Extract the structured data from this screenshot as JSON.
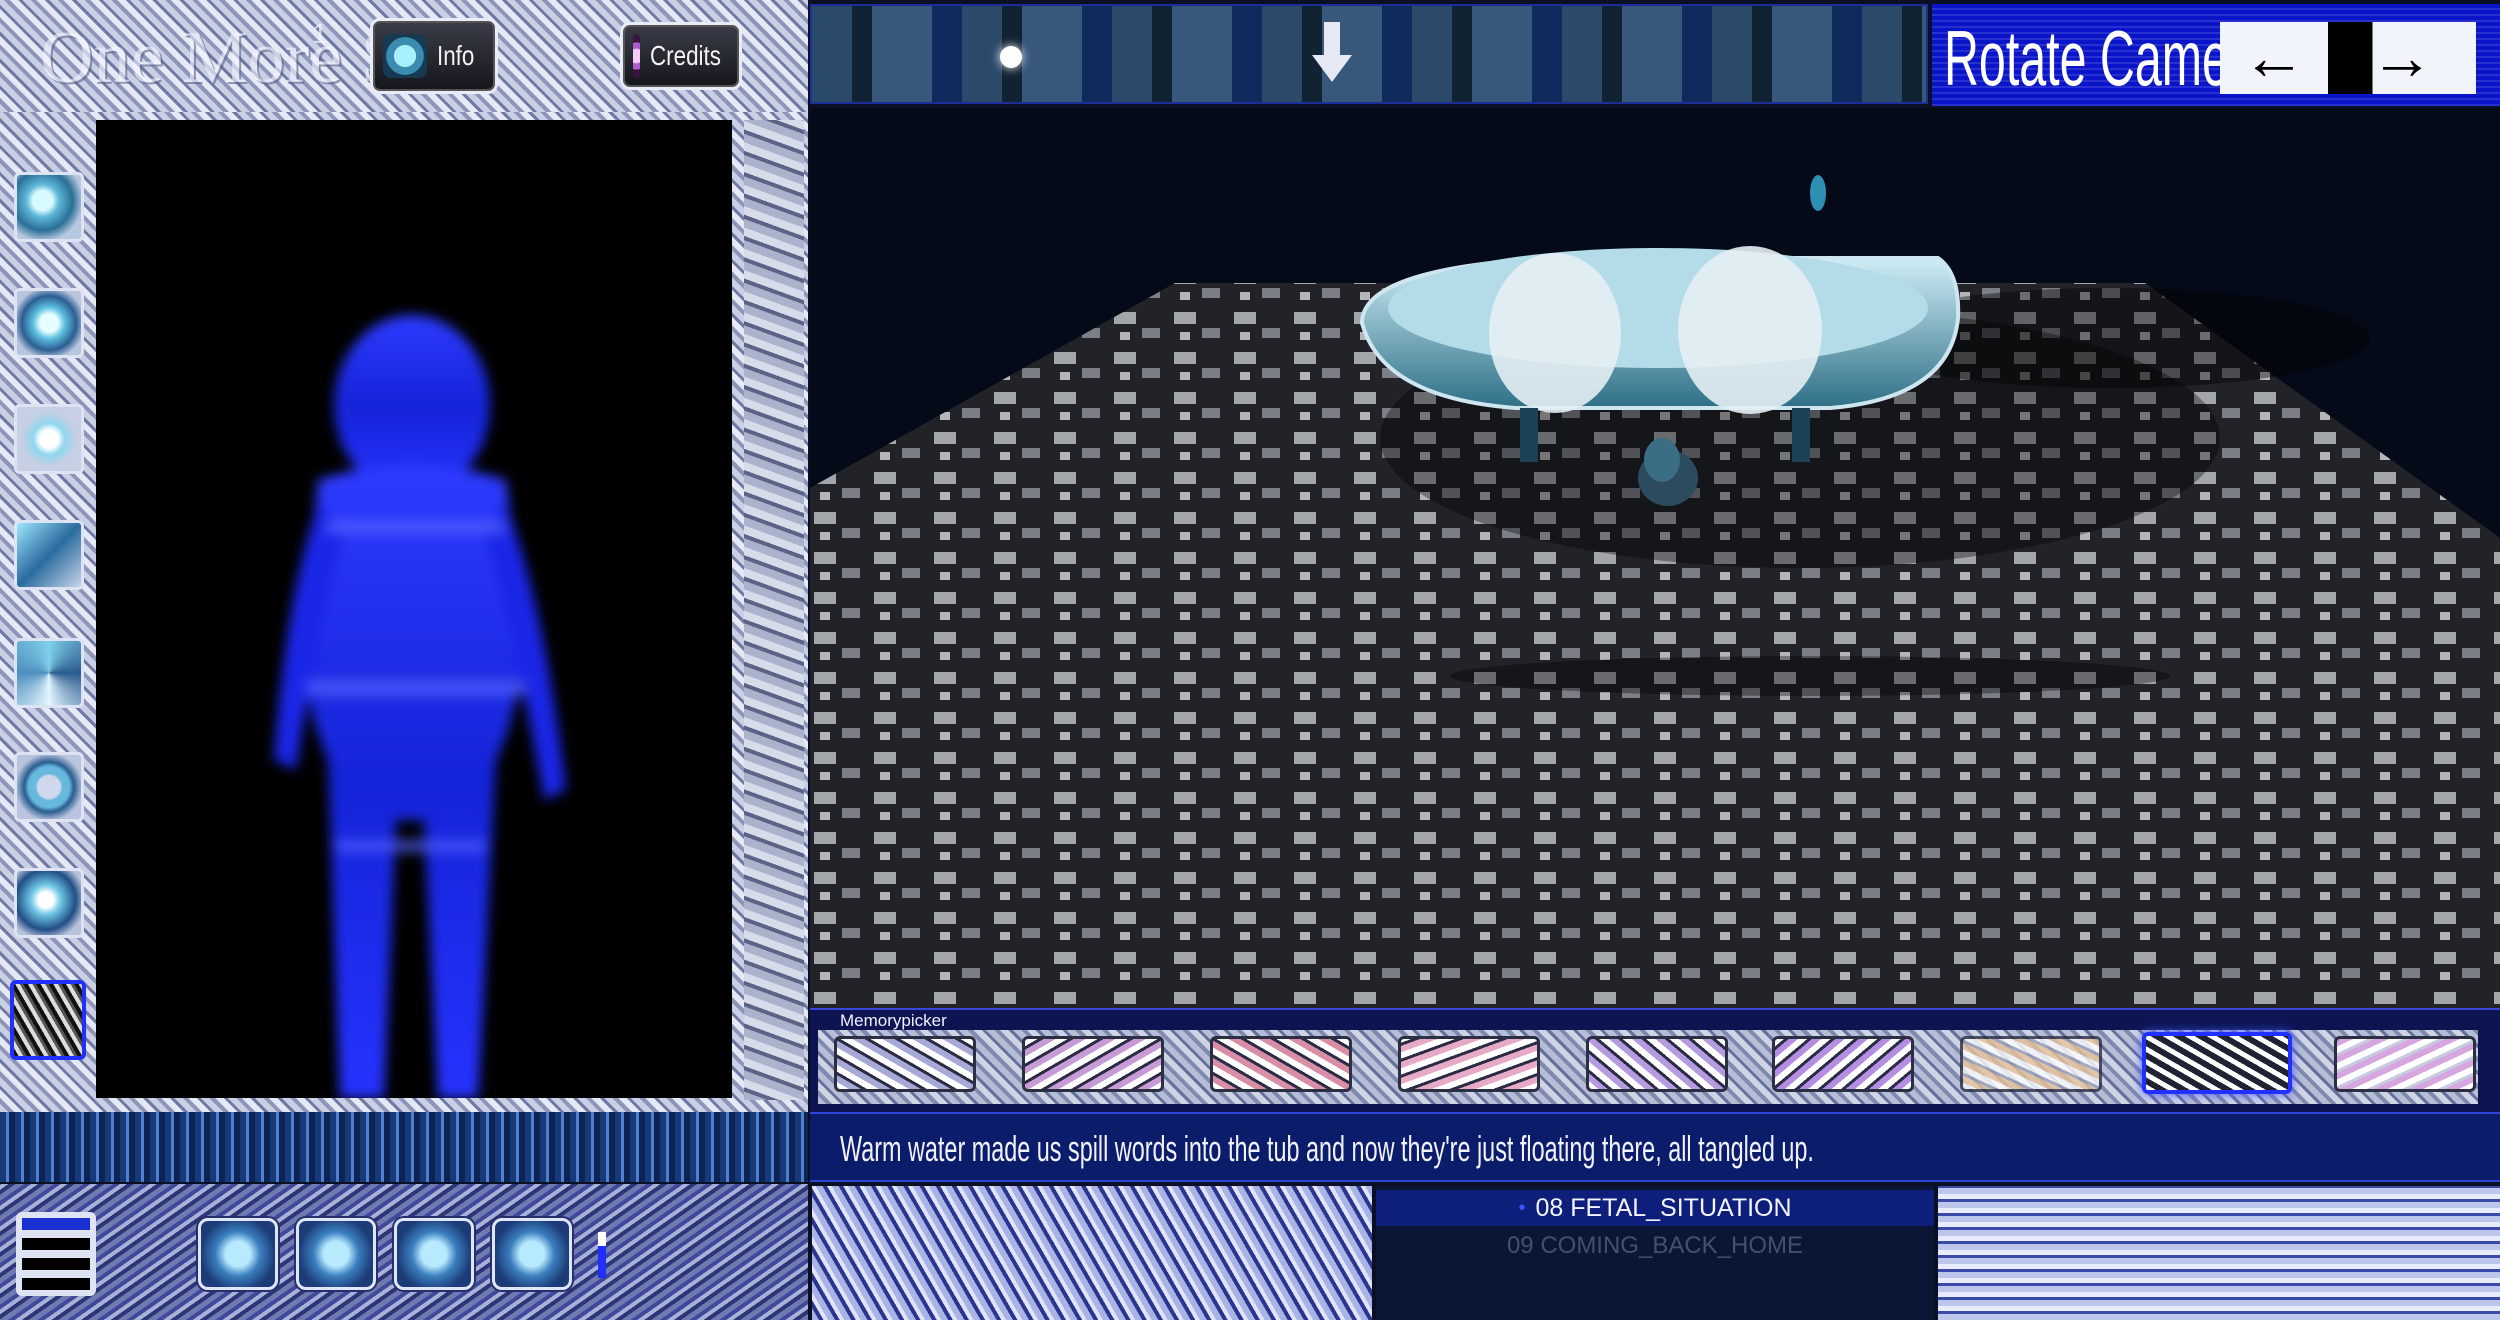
{
  "app": {
    "title": "One More Sim",
    "version_mark": "1"
  },
  "header": {
    "info_label": "Info",
    "credits_label": "Credits"
  },
  "camera": {
    "label": "Rotate Camera",
    "left_arrow": "←",
    "right_arrow": "→"
  },
  "sidebar": {
    "items": [
      {
        "icon": "sphere-icon"
      },
      {
        "icon": "crystal-icon"
      },
      {
        "icon": "eye-icon"
      },
      {
        "icon": "shard-icon"
      },
      {
        "icon": "swirl-icon"
      },
      {
        "icon": "ring-icon"
      },
      {
        "icon": "bubble-icon"
      },
      {
        "icon": "noise-icon"
      }
    ],
    "selected_index": 7
  },
  "memory": {
    "label": "Memorypicker",
    "items": [
      {
        "tint": "#a7a9d6"
      },
      {
        "tint": "#c69bd6"
      },
      {
        "tint": "#d88ea6"
      },
      {
        "tint": "#e6a9c6"
      },
      {
        "tint": "#b59ce0"
      },
      {
        "tint": "#b48ee2"
      },
      {
        "tint": "#e8c49a"
      },
      {
        "tint": "#1e2233"
      },
      {
        "tint": "#d6a6e0"
      }
    ],
    "selected_index": 7
  },
  "dialogue": {
    "text": "Warm water made us spill words into the tub and now they're just floating there, all tangled up."
  },
  "playlist": {
    "current": "08 FETAL_SITUATION",
    "next": "09 COMING_BACK_HOME",
    "current_marker": "•"
  },
  "toolbar": {
    "menu_icon": "hamburger-icon",
    "buttons": [
      {
        "icon": "sliders-icon"
      },
      {
        "icon": "grid-icon"
      },
      {
        "icon": "target-icon"
      },
      {
        "icon": "dolphin-icon"
      }
    ]
  },
  "colors": {
    "accent": "#1a2fd0",
    "panel_bg": "#0b1a46",
    "figure": "#1f2bff"
  }
}
